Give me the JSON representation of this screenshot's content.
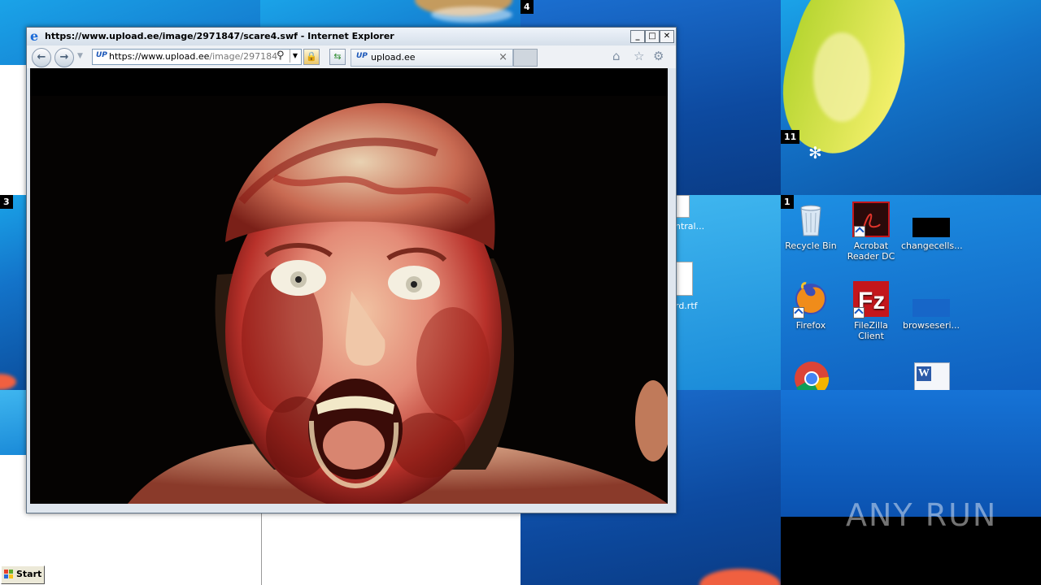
{
  "browser": {
    "title": "https://www.upload.ee/image/2971847/scare4.swf - Internet Explorer",
    "address_host": "https://www.upload.ee",
    "address_path": "/image/2971847/s",
    "tab_label": "upload.ee",
    "tab_icon_text": "UP",
    "minimize": "_",
    "maximize": "□",
    "close": "✕",
    "back_icon": "back-arrow-icon",
    "forward_icon": "forward-arrow-icon",
    "home_icon": "home-icon",
    "favorites_icon": "star-icon",
    "tools_icon": "gear-icon"
  },
  "tiles": {
    "tile_4": "4",
    "tile_11": "11",
    "tile_3": "3",
    "tile_1": "1"
  },
  "partial_labels": {
    "central": "ntral...",
    "rtf": "rd.rtf"
  },
  "desktop_icons": [
    {
      "label": "Recycle Bin",
      "icon": "recycle-bin-icon"
    },
    {
      "label": "Acrobat Reader DC",
      "icon": "acrobat-icon"
    },
    {
      "label": "changecells...",
      "icon": "black-file-icon"
    },
    {
      "label": "Firefox",
      "icon": "firefox-icon"
    },
    {
      "label": "FileZilla Client",
      "icon": "filezilla-icon"
    },
    {
      "label": "browseseri...",
      "icon": "blue-file-icon"
    }
  ],
  "taskbar": {
    "start_label": "Start"
  },
  "watermark": "ANY RUN",
  "colors": {
    "desktop_blue": "#1373c9",
    "ie_accent": "#1a6ad8",
    "acrobat_red": "#c4161c",
    "filezilla_red": "#c4161c"
  }
}
